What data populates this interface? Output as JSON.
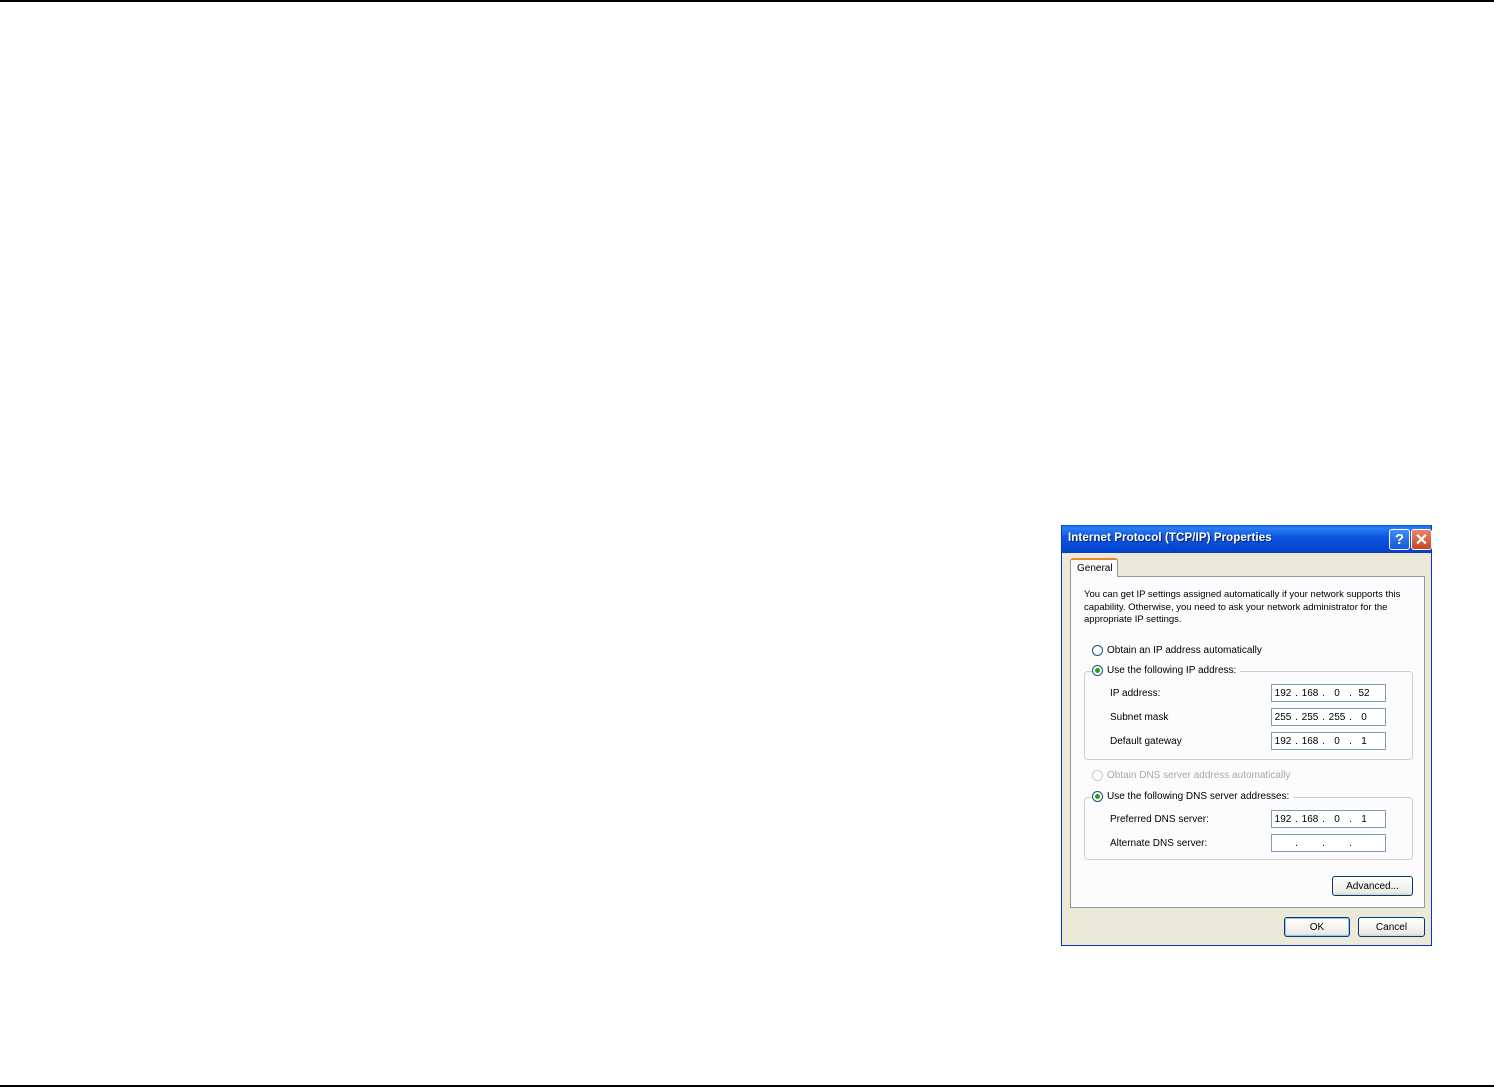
{
  "dialog": {
    "title": "Internet Protocol (TCP/IP) Properties",
    "help_label": "?",
    "close_label": "✕",
    "tab_general": "General",
    "intro_text": "You can get IP settings assigned automatically if your network supports this capability. Otherwise, you need to ask your network administrator for the appropriate IP settings.",
    "ip_mode": {
      "auto_label": "Obtain an IP address automatically",
      "manual_label": "Use the following IP address:",
      "selected": "manual"
    },
    "ip_address": {
      "label": "IP address:",
      "octets": [
        "192",
        "168",
        "0",
        "52"
      ]
    },
    "subnet_mask": {
      "label": "Subnet mask",
      "octets": [
        "255",
        "255",
        "255",
        "0"
      ]
    },
    "default_gateway": {
      "label": "Default gateway",
      "octets": [
        "192",
        "168",
        "0",
        "1"
      ]
    },
    "dns_mode": {
      "auto_label": "Obtain DNS server address automatically",
      "manual_label": "Use the following DNS server addresses:",
      "selected": "manual",
      "auto_disabled": true
    },
    "preferred_dns": {
      "label": "Preferred DNS server:",
      "octets": [
        "192",
        "168",
        "0",
        "1"
      ]
    },
    "alternate_dns": {
      "label": "Alternate DNS server:",
      "octets": [
        "",
        "",
        "",
        ""
      ]
    },
    "buttons": {
      "advanced": "Advanced...",
      "ok": "OK",
      "cancel": "Cancel"
    }
  }
}
